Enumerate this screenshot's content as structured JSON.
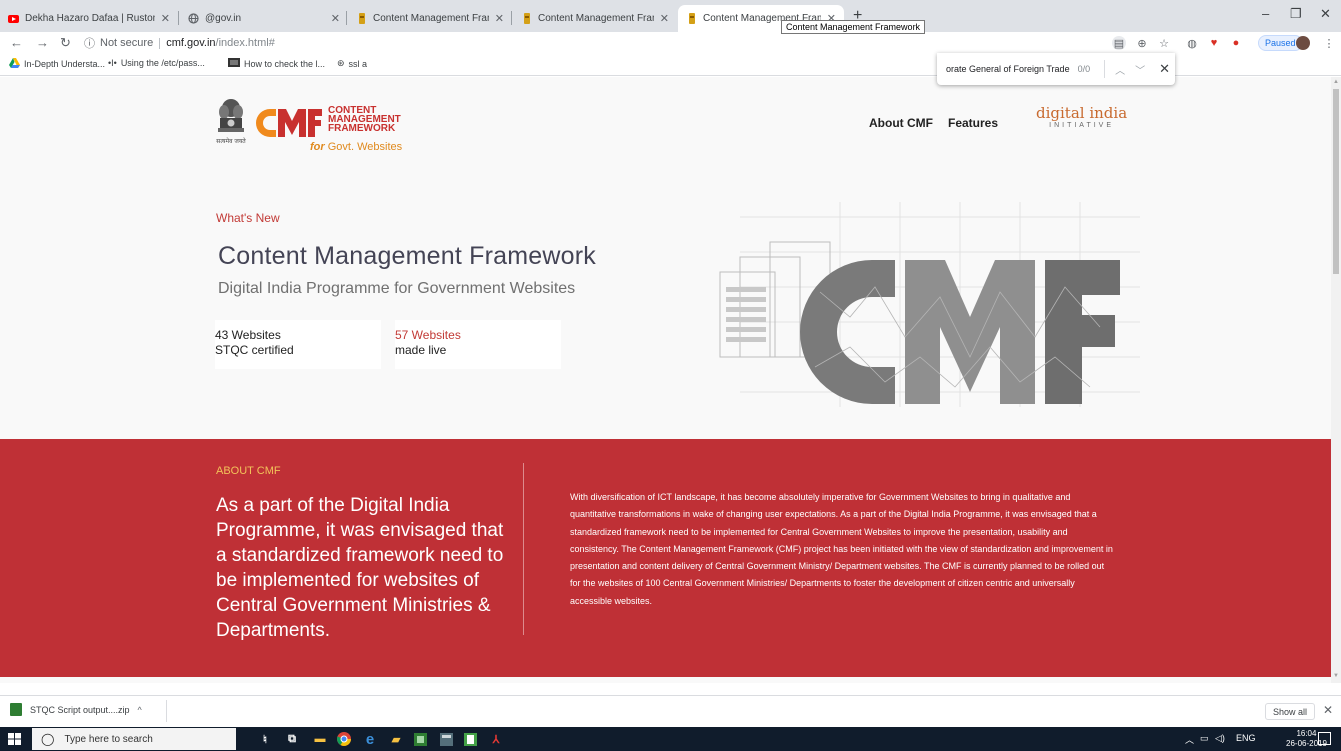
{
  "browser": {
    "tabs": [
      {
        "title": "Dekha Hazaro Dafaa | Rustom | A",
        "favicon": "youtube-icon",
        "active": false
      },
      {
        "title": "@gov.in",
        "favicon": "globe-icon",
        "active": false
      },
      {
        "title": "Content Management Framewo",
        "favicon": "cmf-favicon",
        "active": false
      },
      {
        "title": "Content Management Framewo",
        "favicon": "cmf-favicon",
        "active": false
      },
      {
        "title": "Content Management Framewo",
        "favicon": "cmf-favicon",
        "active": true
      }
    ],
    "tab_tooltip": "Content Management Framework",
    "address": {
      "security": "Not secure",
      "host": "cmf.gov.in",
      "path": "/index.html#"
    },
    "profile_status": "Paused",
    "bookmarks": [
      {
        "label": "In-Depth Understa...",
        "icon": "drive-icon"
      },
      {
        "label": "Using the /etc/pass...",
        "icon": "bookmark-icon"
      },
      {
        "label": "How to check the l...",
        "icon": "bookmark-icon"
      },
      {
        "label": "ssl a",
        "icon": "globe-icon"
      }
    ],
    "find_bar": {
      "query": "orate General of Foreign Trade",
      "count": "0/0"
    }
  },
  "page": {
    "nav": {
      "about": "About CMF",
      "features": "Features"
    },
    "logo": {
      "line1": "CONTENT",
      "line2": "MANAGEMENT",
      "line3": "FRAMEWORK",
      "for_word": "for",
      "for_rest": "Govt. Websites",
      "emblem_caption": "सत्यमेव जयते"
    },
    "digital_india": {
      "line1": "digital india",
      "line2": "INITIATIVE"
    },
    "hero": {
      "kicker": "What's New",
      "title": "Content Management Framework",
      "subtitle": "Digital India Programme for Government Websites",
      "stat1": {
        "line1": "43 Websites",
        "line2": "STQC certified"
      },
      "stat2": {
        "number": "57 Websites",
        "label": "made live"
      }
    },
    "about": {
      "kicker": "ABOUT CMF",
      "lead": "As a part of the Digital India Programme, it was envisaged that a standardized framework need to be implemented for websites of Central Government Ministries & Departments.",
      "body": "With diversification of ICT landscape, it has become absolutely imperative for Government Websites to bring in qualitative and quantitative transformations in wake of changing user expectations. As a part of the Digital India Programme, it was envisaged that a standardized framework need to be implemented for Central Government Websites to improve the presentation, usability and consistency. The Content Management Framework (CMF) project has been initiated with the view of standardization and improvement in presentation and content delivery of Central Government Ministry/ Department websites. The CMF is currently planned to be rolled out for the websites of 100 Central Government Ministries/ Departments to foster the development of citizen centric and universally accessible websites."
    }
  },
  "downloads": {
    "file": "STQC Script output....zip",
    "show_all": "Show all"
  },
  "taskbar": {
    "search_placeholder": "Type here to search",
    "language": "ENG",
    "time": "16:04",
    "date": "26-06-2019"
  },
  "colors": {
    "brand_red": "#bf3036",
    "accent_orange": "#e08a1e",
    "chrome_tab_bg": "#dee1e6"
  }
}
